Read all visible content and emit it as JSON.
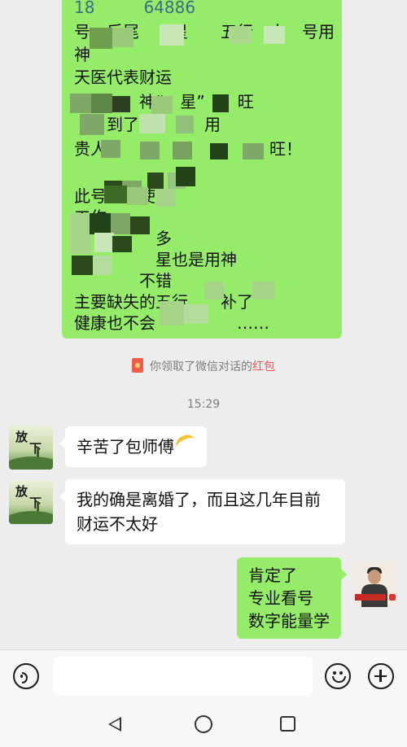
{
  "chat": {
    "top_bubble_lines": [
      "18　　　64886",
      "号　后尾　　星　　五行　土　号用",
      "神",
      "天医代表财运",
      "　　　　神“　星”　　旺",
      "　　到了调　　　用",
      "贵人　　　　　　　　　　旺！",
      "",
      "此号　　使　　　",
      "工作　　　　",
      "好　　　　多",
      "　　　　　星也是用神",
      "　　　　不错",
      "主要缺失的五行　　补了",
      "健康也不会　　　　　……"
    ],
    "red_packet_notice": {
      "prefix": "你领取了微信对话的",
      "highlight": "红包"
    },
    "timestamp": "15:29",
    "messages": [
      {
        "sender": "other",
        "avatar_text": [
          "放",
          "下"
        ],
        "text": "辛苦了包师傅"
      },
      {
        "sender": "other",
        "avatar_text": [
          "放",
          "下"
        ],
        "text_lines": [
          "我的确是离婚了，而且这几年目前",
          "财运不太好"
        ]
      },
      {
        "sender": "self",
        "text_lines": [
          "肯定了",
          "专业看号",
          "数字能量学"
        ]
      }
    ]
  },
  "input_bar": {
    "placeholder": "",
    "icons": [
      "voice-icon",
      "emoji-icon",
      "plus-icon"
    ]
  },
  "nav_bar": {
    "icons": [
      "back-icon",
      "home-icon",
      "recent-apps-icon"
    ]
  },
  "colors": {
    "self_bubble": "#95ec69",
    "other_bubble": "#ffffff",
    "background": "#ededed",
    "red_packet_highlight": "#fa5151"
  }
}
